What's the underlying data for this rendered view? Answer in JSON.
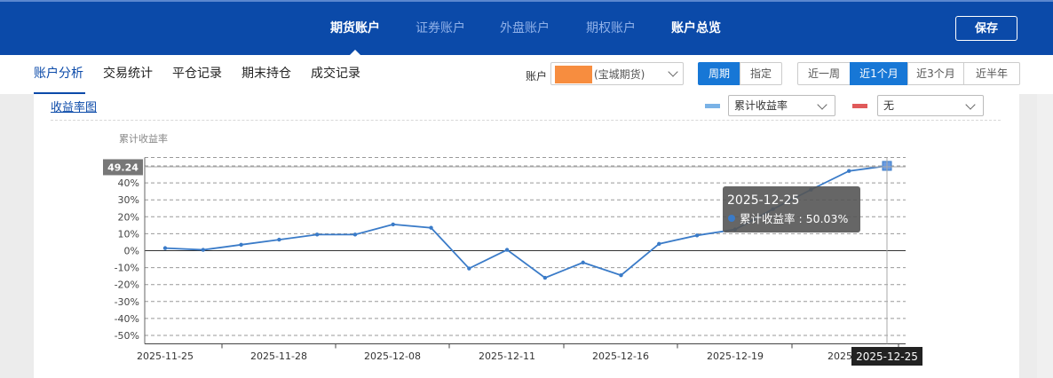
{
  "topnav": {
    "items": [
      "期货账户",
      "证券账户",
      "外盘账户",
      "期权账户",
      "账户总览"
    ],
    "save_label": "保存"
  },
  "subnav": {
    "tabs": [
      "账户分析",
      "交易统计",
      "平仓记录",
      "期末持仓",
      "成交记录"
    ]
  },
  "account": {
    "label": "账户",
    "value": "(宝城期货)"
  },
  "mode": {
    "options": [
      "周期",
      "指定"
    ],
    "selected": "周期"
  },
  "period": {
    "options": [
      "近一周",
      "近1个月",
      "近3个月",
      "近半年"
    ],
    "selected": "近1个月"
  },
  "chart_panel": {
    "link": "收益率图",
    "series_select": "累计收益率",
    "compare_select": "无",
    "series_color": "#7ab2e6",
    "compare_color": "#e05a5a"
  },
  "chart_data": {
    "type": "line",
    "ylabel": "累计收益率",
    "yticks": [
      "50%",
      "40%",
      "30%",
      "20%",
      "10%",
      "0%",
      "-10%",
      "-20%",
      "-30%",
      "-40%",
      "-50%"
    ],
    "ylim": [
      -55,
      55
    ],
    "xticks": [
      "2025-11-25",
      "2025-11-28",
      "2025-12-08",
      "2025-12-11",
      "2025-12-16",
      "2025-12-19",
      "2025-"
    ],
    "grid": true,
    "line_color": "#3a7bc8",
    "series": [
      {
        "values": [
          1.5,
          0.5,
          3.5,
          6.5,
          9.5,
          9.5,
          15.5,
          13.5,
          -10.5,
          0.5,
          -16,
          -7,
          -14.5,
          4,
          9,
          12.5,
          24.5,
          36,
          47,
          50.03
        ]
      }
    ],
    "marker_value_label": "49.24",
    "cursor_date_label": "2025-12-25",
    "tooltip": {
      "date": "2025-12-25",
      "series": "累计收益率",
      "value": "50.03%"
    }
  }
}
